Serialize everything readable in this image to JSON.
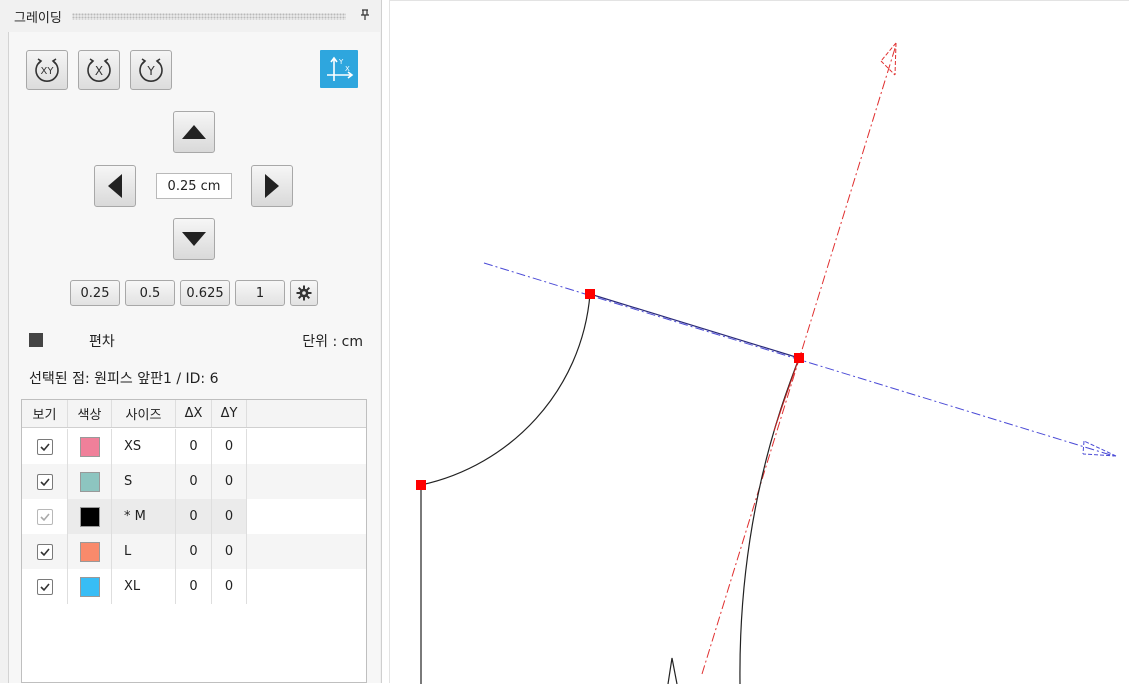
{
  "panel": {
    "title": "그레이딩",
    "pin_icon": "pin-icon"
  },
  "toolbar": {
    "mirror_buttons": [
      "mirror-xy-icon",
      "mirror-x-icon",
      "mirror-y-icon"
    ],
    "axis_toggle_icon": "axis-xy-icon",
    "axis_toggle_color": "#2ea6de"
  },
  "stepper": {
    "value": "0.25 cm"
  },
  "presets": [
    "0.25",
    "0.5",
    "0.625",
    "1"
  ],
  "deviation": {
    "label": "편차",
    "unit": "단위 : cm"
  },
  "selection": {
    "label": "선택된 점: 원피스 앞판1 / ID: 6"
  },
  "table": {
    "headers": [
      "보기",
      "색상",
      "사이즈",
      "ΔX",
      "ΔY"
    ],
    "rows": [
      {
        "visible": true,
        "color": "#f0809a",
        "size": "XS",
        "dx": "0",
        "dy": "0",
        "enabled": true
      },
      {
        "visible": true,
        "color": "#8dc5c0",
        "size": "S",
        "dx": "0",
        "dy": "0",
        "enabled": true
      },
      {
        "visible": true,
        "color": "#000000",
        "size": "* M",
        "dx": "0",
        "dy": "0",
        "enabled": false
      },
      {
        "visible": true,
        "color": "#f98a6b",
        "size": "L",
        "dx": "0",
        "dy": "0",
        "enabled": true
      },
      {
        "visible": true,
        "color": "#38bdf5",
        "size": "XL",
        "dx": "0",
        "dy": "0",
        "enabled": true
      }
    ]
  },
  "canvas": {
    "x_axis_color": "#4a4ad6",
    "y_axis_color": "#e03030",
    "point_color": "#ff0000",
    "line_color": "#2a2a7a",
    "curve_color": "#222222"
  }
}
